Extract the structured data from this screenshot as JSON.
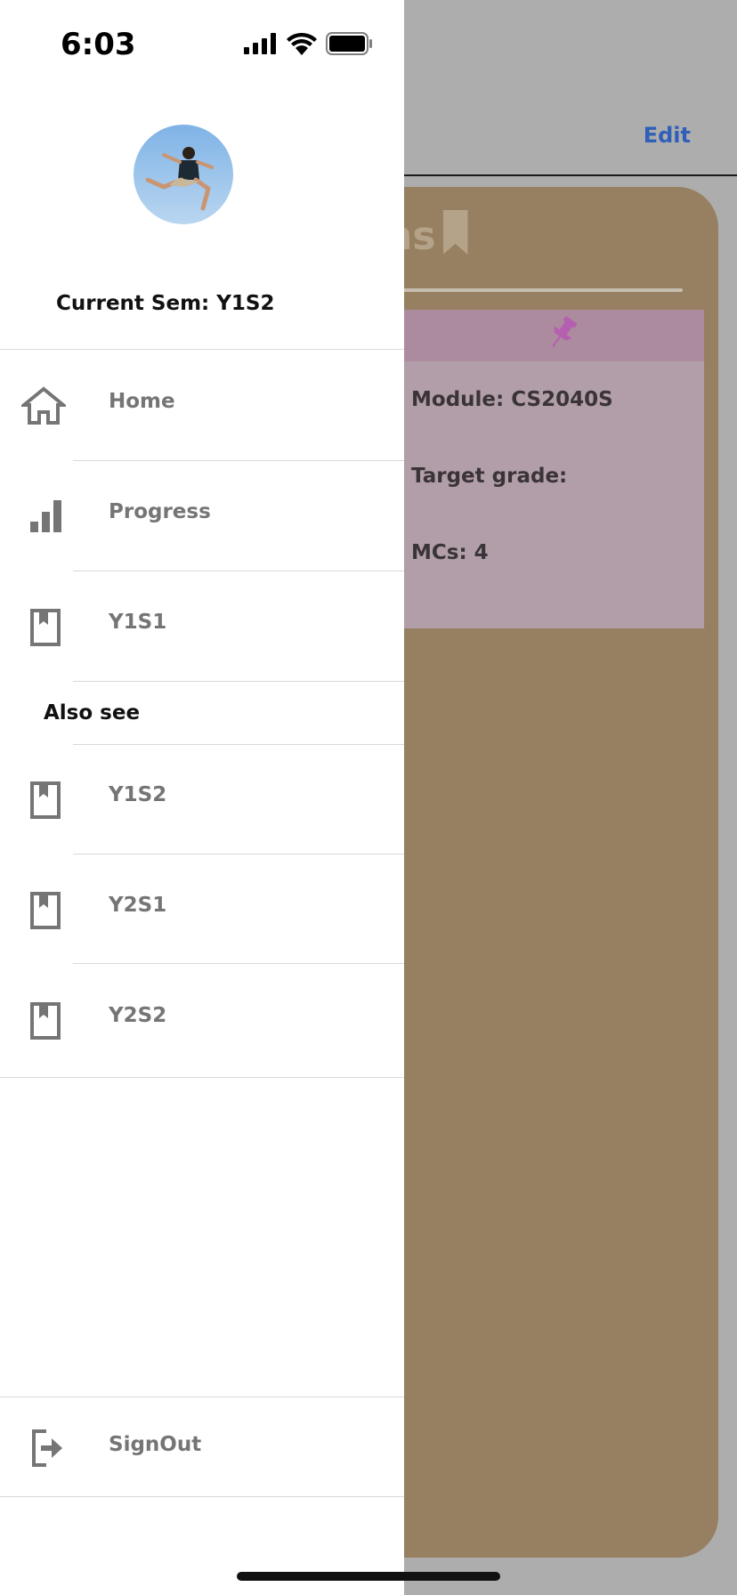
{
  "status_bar": {
    "time": "6:03"
  },
  "background": {
    "edit_label": "Edit",
    "panel_title_partial": "ns",
    "card": {
      "module_line": "Module: CS2040S",
      "target_line": "Target grade:",
      "mcs_line": "MCs: 4"
    },
    "colors": {
      "panel": "#978061",
      "card": "#b19ea8",
      "pin": "#b55fb0",
      "edit": "#2f5fb8"
    }
  },
  "drawer": {
    "current_sem": "Current Sem: Y1S2",
    "items": [
      {
        "label": "Home",
        "icon": "home-icon"
      },
      {
        "label": "Progress",
        "icon": "bar-chart-icon"
      },
      {
        "label": "Y1S1",
        "icon": "bookmark-icon"
      }
    ],
    "also_see_label": "Also see",
    "also_see_items": [
      {
        "label": "Y1S2",
        "icon": "bookmark-icon"
      },
      {
        "label": "Y2S1",
        "icon": "bookmark-icon"
      },
      {
        "label": "Y2S2",
        "icon": "bookmark-icon"
      }
    ],
    "signout": {
      "label": "SignOut",
      "icon": "logout-icon"
    }
  }
}
